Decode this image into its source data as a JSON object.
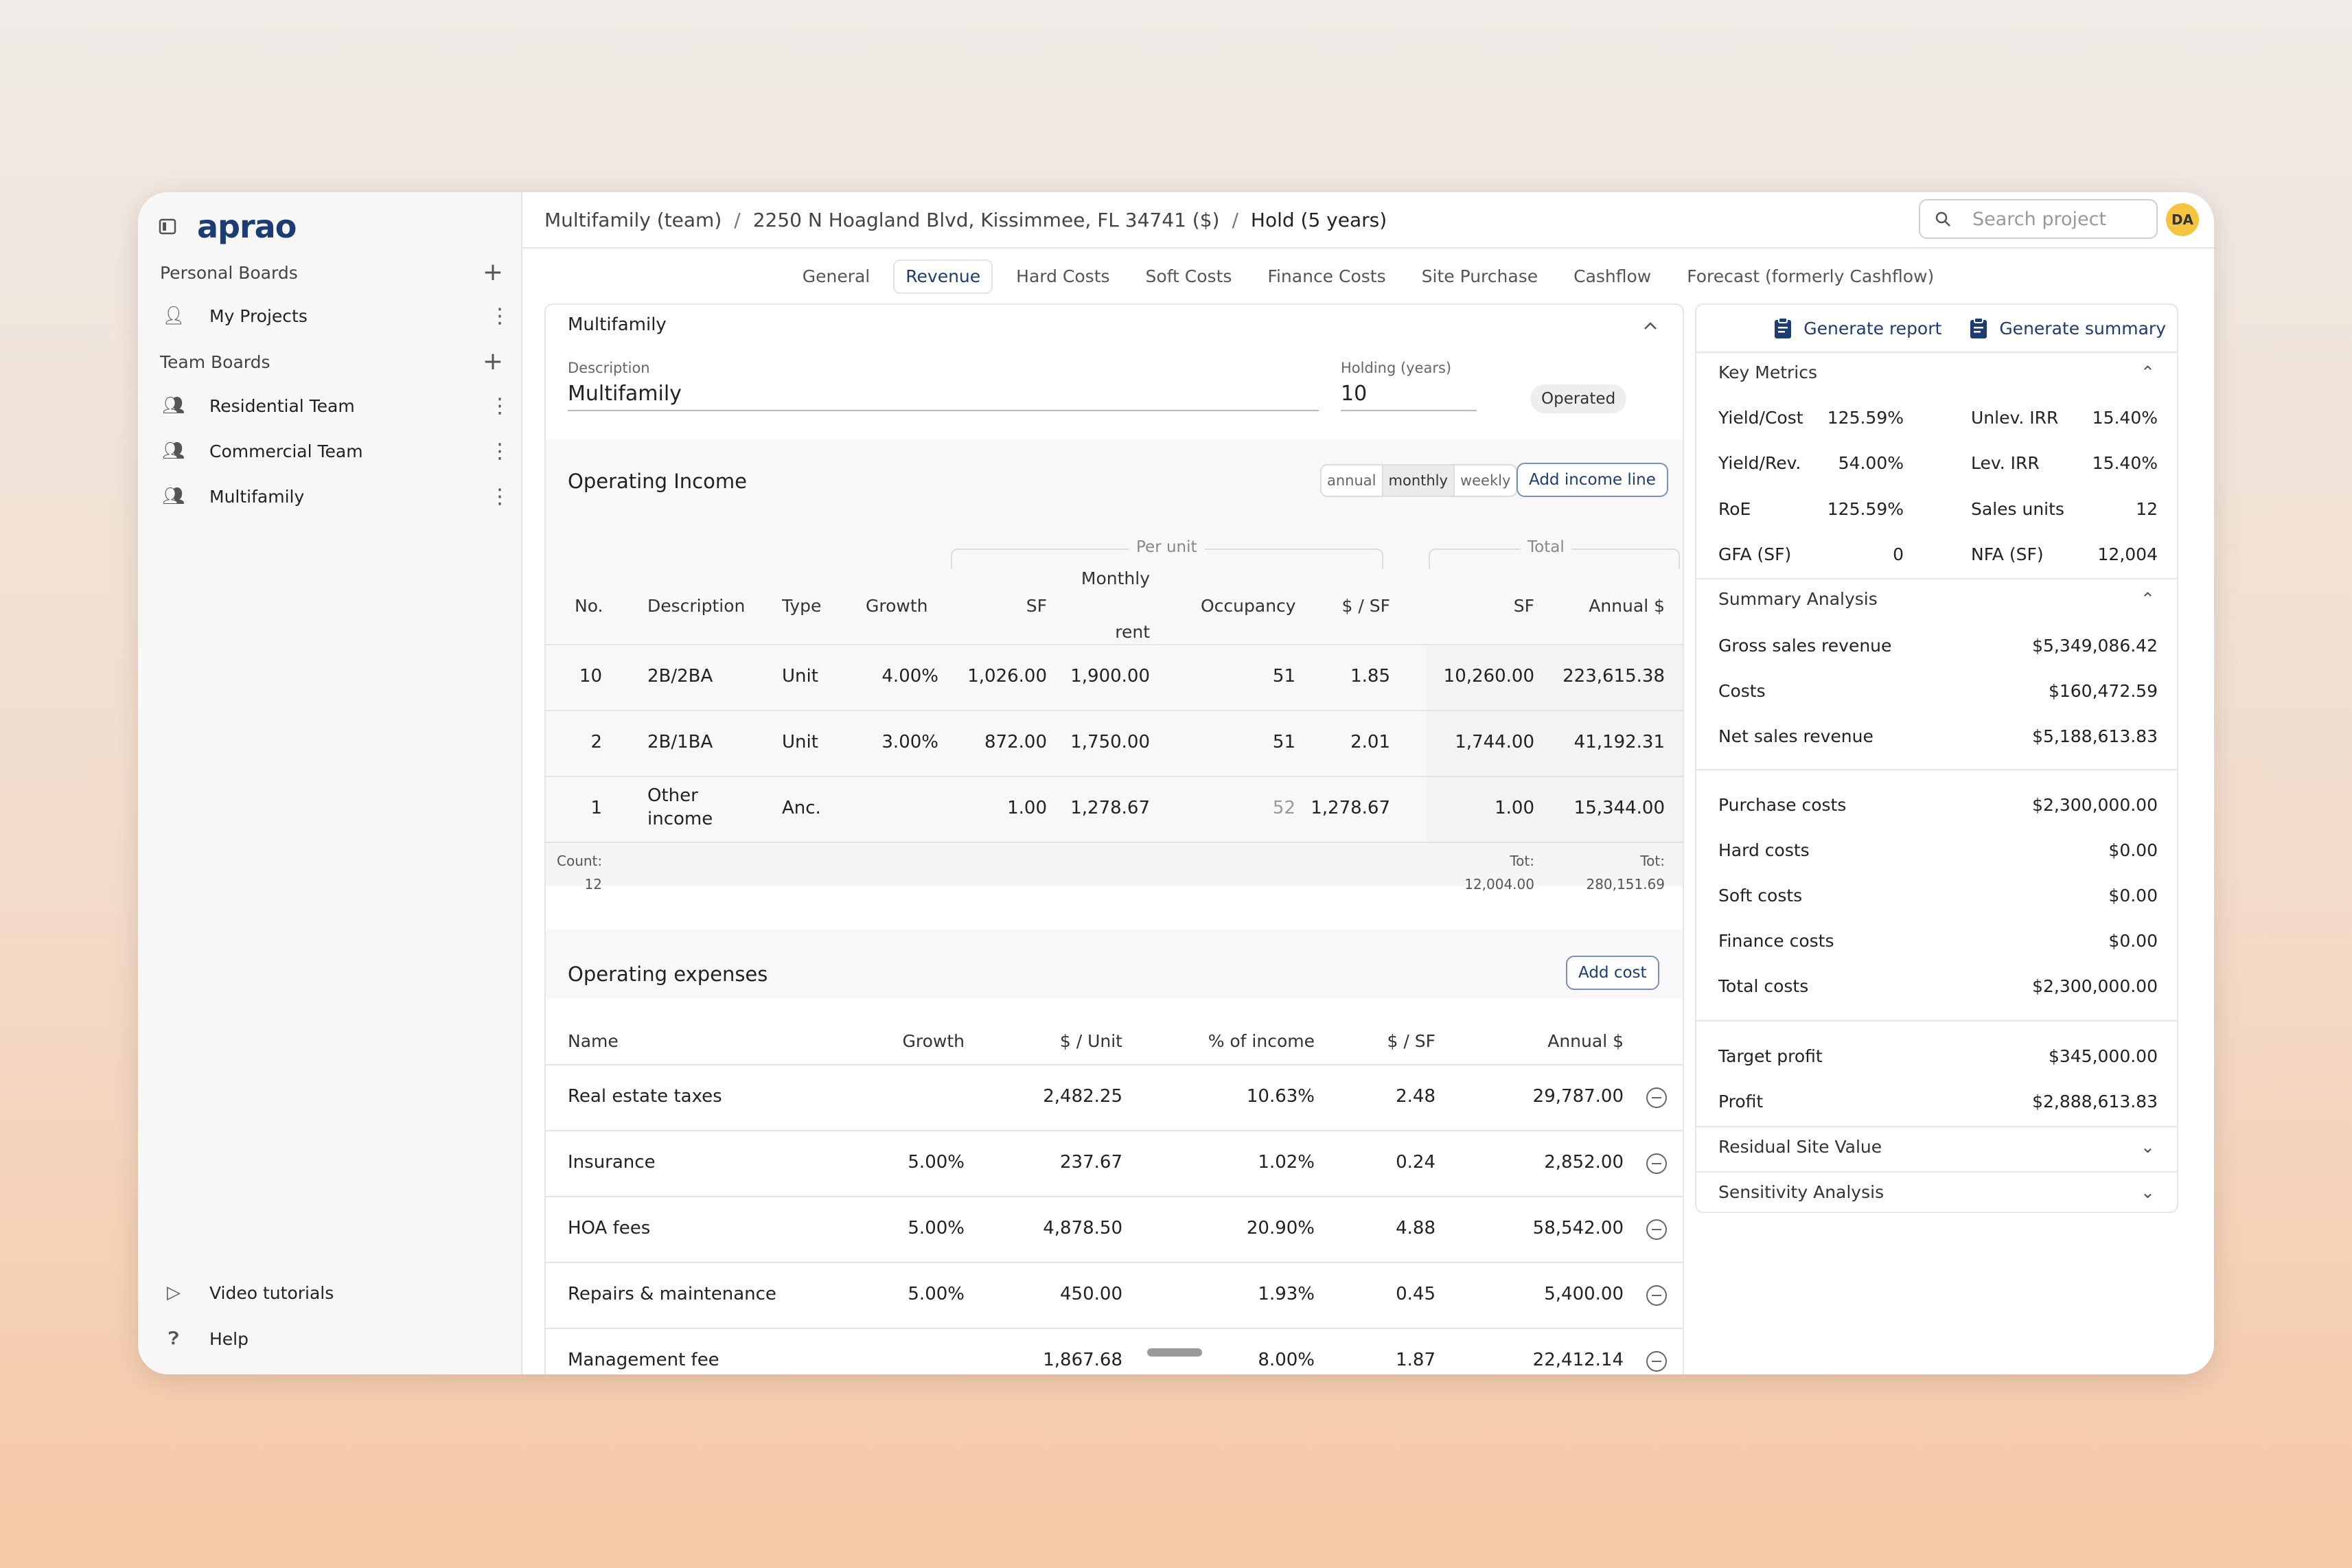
{
  "app": {
    "logo": "aprao"
  },
  "sidebar": {
    "personal_boards": "Personal Boards",
    "my_projects": "My Projects",
    "team_boards": "Team Boards",
    "teams": [
      "Residential Team",
      "Commercial Team",
      "Multifamily"
    ],
    "video": "Video tutorials",
    "help": "Help"
  },
  "breadcrumb": {
    "b1": "Multifamily (team)",
    "b2": "2250 N Hoagland Blvd, Kissimmee, FL 34741 ($)",
    "b3": "Hold (5 years)",
    "sep": "/"
  },
  "search": {
    "placeholder": "Search project"
  },
  "user": {
    "initials": "DA"
  },
  "tabs": [
    "General",
    "Revenue",
    "Hard Costs",
    "Soft Costs",
    "Finance Costs",
    "Site Purchase",
    "Cashflow",
    "Forecast (formerly Cashflow)"
  ],
  "card": {
    "title": "Multifamily",
    "desc_label": "Description",
    "desc_value": "Multifamily",
    "hold_label": "Holding (years)",
    "hold_value": "10",
    "badge": "Operated"
  },
  "income": {
    "title": "Operating Income",
    "seg": [
      "annual",
      "monthly",
      "weekly"
    ],
    "add": "Add income line",
    "group_per_unit": "Per unit",
    "group_total": "Total",
    "headers": [
      "No.",
      "Description",
      "Type",
      "Growth",
      "SF",
      "Monthly",
      "rent",
      "Occupancy",
      "$ / SF",
      "SF",
      "Annual $"
    ],
    "rows": [
      {
        "no": "10",
        "desc": "2B/2BA",
        "desc2": "",
        "type": "Unit",
        "growth": "4.00%",
        "sf": "1,026.00",
        "rent": "1,900.00",
        "occ": "51",
        "psf": "1.85",
        "tsf": "10,260.00",
        "annual": "223,615.38"
      },
      {
        "no": "2",
        "desc": "2B/1BA",
        "desc2": "",
        "type": "Unit",
        "growth": "3.00%",
        "sf": "872.00",
        "rent": "1,750.00",
        "occ": "51",
        "psf": "2.01",
        "tsf": "1,744.00",
        "annual": "41,192.31"
      },
      {
        "no": "1",
        "desc": "Other",
        "desc2": "income",
        "type": "Anc.",
        "growth": "",
        "sf": "1.00",
        "rent": "1,278.67",
        "occ": "52",
        "psf": "1,278.67",
        "tsf": "1.00",
        "annual": "15,344.00"
      }
    ],
    "count_label": "Count:",
    "count": "12",
    "tot_label": "Tot:",
    "tot_sf": "12,004.00",
    "tot_annual": "280,151.69"
  },
  "expenses": {
    "title": "Operating expenses",
    "add": "Add cost",
    "headers": [
      "Name",
      "Growth",
      "$ / Unit",
      "% of income",
      "$ / SF",
      "Annual $"
    ],
    "rows": [
      {
        "name": "Real estate taxes",
        "growth": "",
        "unit": "2,482.25",
        "pct": "10.63%",
        "psf": "2.48",
        "annual": "29,787.00"
      },
      {
        "name": "Insurance",
        "growth": "5.00%",
        "unit": "237.67",
        "pct": "1.02%",
        "psf": "0.24",
        "annual": "2,852.00"
      },
      {
        "name": "HOA fees",
        "growth": "5.00%",
        "unit": "4,878.50",
        "pct": "20.90%",
        "psf": "4.88",
        "annual": "58,542.00"
      },
      {
        "name": "Repairs & maintenance",
        "growth": "5.00%",
        "unit": "450.00",
        "pct": "1.93%",
        "psf": "0.45",
        "annual": "5,400.00"
      },
      {
        "name": "Management fee",
        "growth": "",
        "unit": "1,867.68",
        "pct": "8.00%",
        "psf": "1.87",
        "annual": "22,412.14"
      }
    ]
  },
  "panel": {
    "gen_report": "Generate report",
    "gen_summary": "Generate summary",
    "key_metrics": "Key Metrics",
    "metrics": [
      [
        "Yield/Cost",
        "125.59%",
        "Unlev. IRR",
        "15.40%"
      ],
      [
        "Yield/Rev.",
        "54.00%",
        "Lev. IRR",
        "15.40%"
      ],
      [
        "RoE",
        "125.59%",
        "Sales units",
        "12"
      ],
      [
        "GFA (SF)",
        "0",
        "NFA (SF)",
        "12,004"
      ]
    ],
    "summary": "Summary Analysis",
    "s1": [
      [
        "Gross sales revenue",
        "$5,349,086.42"
      ],
      [
        "Costs",
        "$160,472.59"
      ],
      [
        "Net sales revenue",
        "$5,188,613.83"
      ]
    ],
    "s2": [
      [
        "Purchase costs",
        "$2,300,000.00"
      ],
      [
        "Hard costs",
        "$0.00"
      ],
      [
        "Soft costs",
        "$0.00"
      ],
      [
        "Finance costs",
        "$0.00"
      ],
      [
        "Total costs",
        "$2,300,000.00"
      ]
    ],
    "s3": [
      [
        "Target profit",
        "$345,000.00"
      ],
      [
        "Profit",
        "$2,888,613.83"
      ]
    ],
    "residual": "Residual Site Value",
    "sensitivity": "Sensitivity Analysis"
  }
}
